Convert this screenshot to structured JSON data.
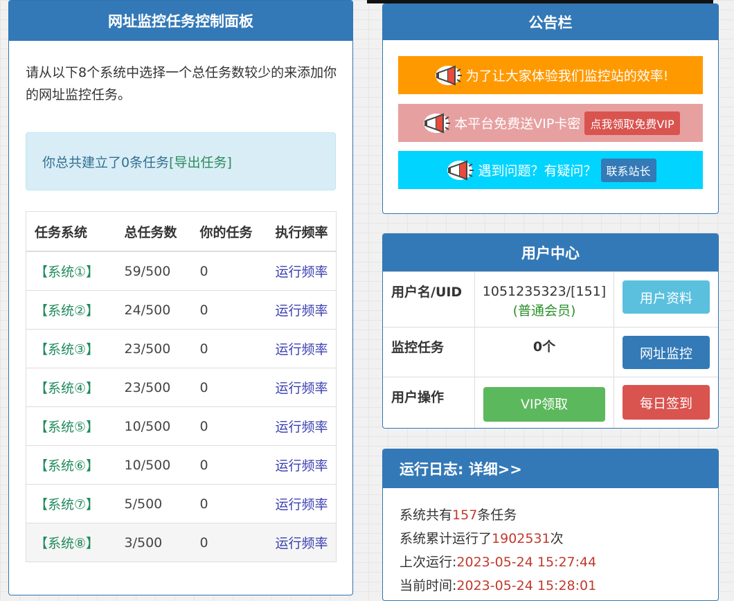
{
  "left": {
    "title": "网址监控任务控制面板",
    "intro": "请从以下8个系统中选择一个总任务数较少的来添加你的网址监控任务。",
    "total_prefix": "你总共建立了0条任务 ",
    "export_link": "[导出任务]",
    "table": {
      "headers": [
        "任务系统",
        "总任务数",
        "你的任务",
        "执行频率"
      ],
      "rows": [
        {
          "system": "【系统①】",
          "total": "59/500",
          "mine": "0",
          "freq": "运行频率"
        },
        {
          "system": "【系统②】",
          "total": "24/500",
          "mine": "0",
          "freq": "运行频率"
        },
        {
          "system": "【系统③】",
          "total": "23/500",
          "mine": "0",
          "freq": "运行频率"
        },
        {
          "system": "【系统④】",
          "total": "23/500",
          "mine": "0",
          "freq": "运行频率"
        },
        {
          "system": "【系统⑤】",
          "total": "10/500",
          "mine": "0",
          "freq": "运行频率"
        },
        {
          "system": "【系统⑥】",
          "total": "10/500",
          "mine": "0",
          "freq": "运行频率"
        },
        {
          "system": "【系统⑦】",
          "total": "5/500",
          "mine": "0",
          "freq": "运行频率"
        },
        {
          "system": "【系统⑧】",
          "total": "3/500",
          "mine": "0",
          "freq": "运行频率"
        }
      ]
    }
  },
  "notice": {
    "title": "公告栏",
    "row1": {
      "text": "为了让大家体验我们监控站的效率!",
      "color": "#ff9900"
    },
    "row2": {
      "text": "本平台免费送VIP卡密",
      "button": "点我领取免费VIP",
      "color": "#e7a0a0",
      "button_color": "#d9534f"
    },
    "row3": {
      "text": "遇到问题？有疑问？",
      "button": "联系站长",
      "color": "#00d4ff",
      "button_color": "#337ab7"
    },
    "icon": "megaphone-icon"
  },
  "user": {
    "title": "用户中心",
    "uid_label": "用户名/UID",
    "uid_value": "1051235323/[151]",
    "member_level": "(普通会员)",
    "profile_button": "用户资料",
    "tasks_label": "监控任务",
    "tasks_value": "0个",
    "monitor_button": "网址监控",
    "ops_label": "用户操作",
    "vip_button": "VIP领取",
    "checkin_button": "每日签到",
    "colors": {
      "profile": "#5bc0de",
      "monitor": "#337ab7",
      "vip": "#5cb85c",
      "checkin": "#d9534f"
    }
  },
  "log": {
    "title": "运行日志: 详细>>",
    "line1_prefix": "系统共有",
    "line1_value": "157",
    "line1_suffix": "条任务",
    "line2_prefix": "系统累计运行了",
    "line2_value": "1902531",
    "line2_suffix": "次",
    "line3_prefix": "上次运行:",
    "line3_value": "2023-05-24 15:27:44",
    "line4_prefix": "当前时间:",
    "line4_value": "2023-05-24 15:28:01"
  }
}
